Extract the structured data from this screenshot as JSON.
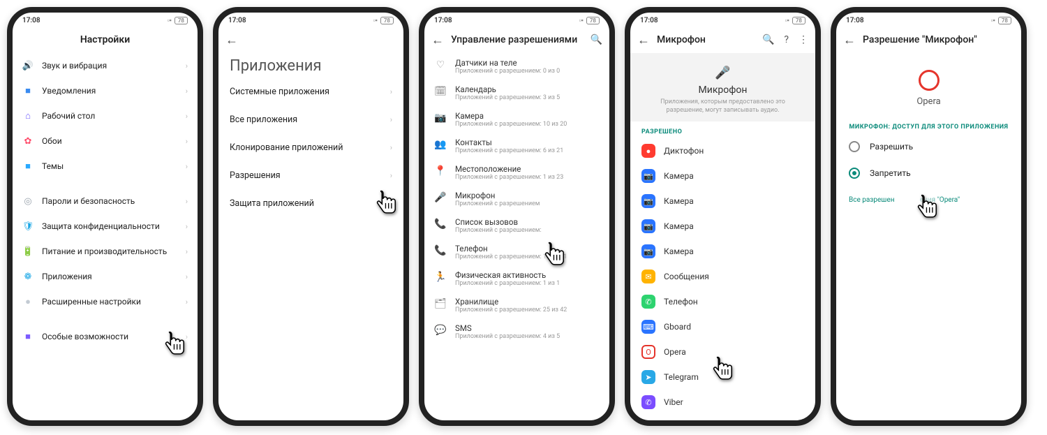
{
  "status": {
    "time": "17:08",
    "alarm": "⏰",
    "signal": "▫▫",
    "battery": "78"
  },
  "p1": {
    "title": "Настройки",
    "groupA": [
      {
        "icon": "🔊",
        "color": "#2abf6e",
        "label": "Звук и вибрация"
      },
      {
        "icon": "■",
        "color": "#3a8bf0",
        "label": "Уведомления"
      },
      {
        "icon": "⌂",
        "color": "#6f5cff",
        "label": "Рабочий стол"
      },
      {
        "icon": "✿",
        "color": "#ff4f6d",
        "label": "Обои"
      },
      {
        "icon": "■",
        "color": "#2aa9ff",
        "label": "Темы"
      }
    ],
    "groupB": [
      {
        "icon": "◎",
        "color": "#9aa3ad",
        "label": "Пароли и безопасность"
      },
      {
        "icon": "🛡",
        "color": "#1aa7e6",
        "label": "Защита конфиденциальности"
      },
      {
        "icon": "🔋",
        "color": "#34c759",
        "label": "Питание и производительность"
      },
      {
        "icon": "❁",
        "color": "#1aa7e6",
        "label": "Приложения"
      },
      {
        "icon": "●",
        "color": "#c3cbd3",
        "label": "Расширенные настройки"
      }
    ],
    "groupC": [
      {
        "icon": "■",
        "color": "#7c5cff",
        "label": "Особые возможности"
      }
    ]
  },
  "p2": {
    "big_title": "Приложения",
    "items": [
      "Системные приложения",
      "Все приложения",
      "Клонирование приложений",
      "Разрешения",
      "Защита приложений"
    ]
  },
  "p3": {
    "title": "Управление разрешениями",
    "items": [
      {
        "icon": "♡",
        "title": "Датчики на теле",
        "sub": "Приложений с разрешением: 0 из 0"
      },
      {
        "icon": "🗓",
        "title": "Календарь",
        "sub": "Приложений с разрешением: 3 из 5"
      },
      {
        "icon": "📷",
        "title": "Камера",
        "sub": "Приложений с разрешением: 10 из 20"
      },
      {
        "icon": "👥",
        "title": "Контакты",
        "sub": "Приложений с разрешением: 6 из 21"
      },
      {
        "icon": "📍",
        "title": "Местоположение",
        "sub": "Приложений с разрешением: 1 из 23"
      },
      {
        "icon": "🎤",
        "title": "Микрофон",
        "sub": "Приложений с разрешением"
      },
      {
        "icon": "📞",
        "title": "Список вызовов",
        "sub": "Приложений с разрешением:"
      },
      {
        "icon": "📞",
        "title": "Телефон",
        "sub": "Приложений с разрешением: 10 из 21"
      },
      {
        "icon": "🏃",
        "title": "Физическая активность",
        "sub": "Приложений с разрешением: 1 из 1"
      },
      {
        "icon": "🗂",
        "title": "Хранилище",
        "sub": "Приложений с разрешением: 25 из 42"
      },
      {
        "icon": "💬",
        "title": "SMS",
        "sub": "Приложений с разрешением: 4 из 5"
      }
    ]
  },
  "p4": {
    "title": "Микрофон",
    "header_sub": "Приложения, которым предоставлено это разрешение, могут записывать аудио.",
    "section": "РАЗРЕШЕНО",
    "apps": [
      {
        "bg": "#ff3b30",
        "icon": "●",
        "label": "Диктофон"
      },
      {
        "bg": "#2a74ff",
        "icon": "📷",
        "label": "Камера"
      },
      {
        "bg": "#2a74ff",
        "icon": "📷",
        "label": "Камера"
      },
      {
        "bg": "#2a74ff",
        "icon": "📷",
        "label": "Камера"
      },
      {
        "bg": "#2a74ff",
        "icon": "📷",
        "label": "Камера"
      },
      {
        "bg": "#ffb300",
        "icon": "✉",
        "label": "Сообщения"
      },
      {
        "bg": "#2dd36f",
        "icon": "✆",
        "label": "Телефон"
      },
      {
        "bg": "#2a74ff",
        "icon": "⌨",
        "label": "Gboard"
      },
      {
        "bg": "#ffffff",
        "icon": "O",
        "label": "Opera",
        "fg": "#e5342b",
        "border": true
      },
      {
        "bg": "#29a8e6",
        "icon": "➤",
        "label": "Telegram"
      },
      {
        "bg": "#7b4dff",
        "icon": "✆",
        "label": "Viber"
      }
    ]
  },
  "p5": {
    "title": "Разрешение \"Микрофон\"",
    "app_name": "Opera",
    "section": "МИКРОФОН: ДОСТУП ДЛЯ ЭТОГО ПРИЛОЖЕНИЯ",
    "opt_allow": "Разрешить",
    "opt_deny": "Запретить",
    "all_link_prefix": "Все разрешен",
    "all_link_suffix": "ения \"Opera\""
  }
}
